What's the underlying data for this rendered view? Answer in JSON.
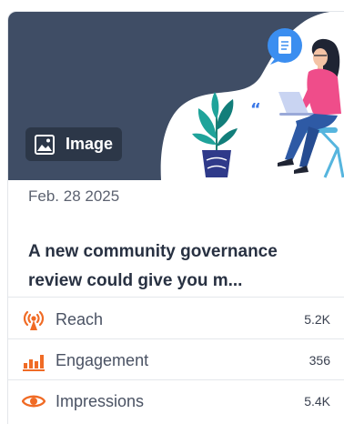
{
  "post": {
    "media_badge": {
      "icon": "image-icon",
      "label": "Image"
    },
    "date": "Feb. 28 2025",
    "title_line1": "A new community governance",
    "title_line2": "review could give you m..."
  },
  "metrics": [
    {
      "icon": "reach-antenna-icon",
      "label": "Reach",
      "value": "5.2K"
    },
    {
      "icon": "engagement-bars-icon",
      "label": "Engagement",
      "value": "356"
    },
    {
      "icon": "impressions-eye-icon",
      "label": "Impressions",
      "value": "5.4K"
    }
  ],
  "colors": {
    "hero_background": "#3f4d65",
    "accent_orange": "#f06b25",
    "text_dark": "#283142"
  }
}
